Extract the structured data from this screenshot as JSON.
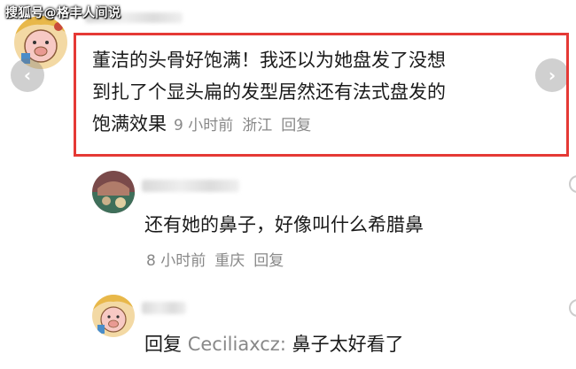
{
  "watermark": "搜狐号@格丰人间说",
  "main_comment": {
    "text_lines": [
      "董洁的头骨好饱满！我还以为她盘发了没想",
      "到扎了个显头扁的发型居然还有法式盘发的",
      "饱满效果"
    ],
    "time": "9 小时前",
    "location": "浙江",
    "reply_label": "回复"
  },
  "replies": [
    {
      "text": "还有她的鼻子，好像叫什么希腊鼻",
      "time": "8 小时前",
      "location": "重庆",
      "reply_label": "回复"
    },
    {
      "prefix": "回复",
      "reply_to": "Ceciliaxcz:",
      "text": "鼻子太好看了"
    }
  ],
  "nav": {
    "left_arrow": "‹",
    "right_arrow": "›"
  },
  "colors": {
    "highlight": "#e53935",
    "meta": "#888888",
    "text": "#1a1a1a"
  }
}
